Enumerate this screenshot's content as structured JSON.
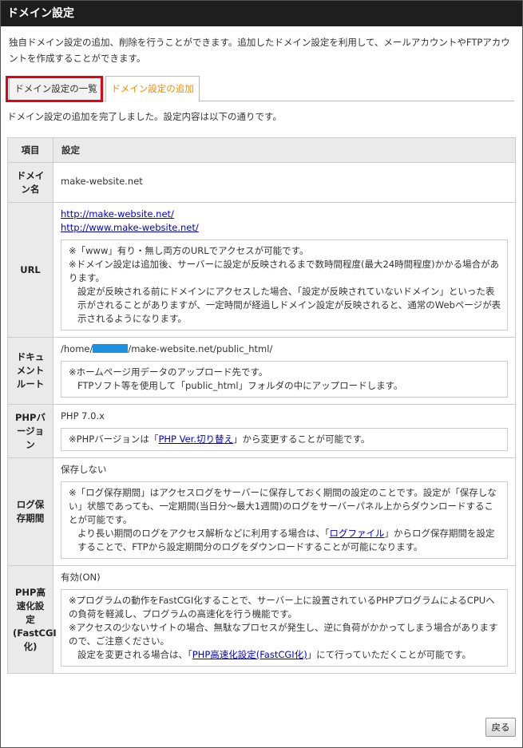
{
  "header": {
    "title": "ドメイン設定"
  },
  "intro": "独自ドメイン設定の追加、削除を行うことができます。追加したドメイン設定を利用して、メールアカウントやFTPアカウントを作成することができます。",
  "tabs": [
    {
      "label": "ドメイン設定の一覧"
    },
    {
      "label": "ドメイン設定の追加"
    }
  ],
  "message": "ドメイン設定の追加を完了しました。設定内容は以下の通りです。",
  "table": {
    "header": {
      "item": "項目",
      "setting": "設定"
    },
    "domain": {
      "label": "ドメイン名",
      "value": "make-website.net"
    },
    "url": {
      "label": "URL",
      "links": [
        "http://make-website.net/",
        "http://www.make-website.net/"
      ],
      "note1": "※「www」有り・無し両方のURLでアクセスが可能です。",
      "note2": "※ドメイン設定は追加後、サーバーに設定が反映されるまで数時間程度(最大24時間程度)かかる場合があります。",
      "note3": "設定が反映される前にドメインにアクセスした場合、「設定が反映されていないドメイン」といった表示がされることがありますが、一定時間が経過しドメイン設定が反映されると、通常のWebページが表示されるようになります。"
    },
    "docroot": {
      "label": "ドキュメントルート",
      "path_prefix": "/home/",
      "path_suffix": "/make-website.net/public_html/",
      "note1": "※ホームページ用データのアップロード先です。",
      "note2": "FTPソフト等を使用して「public_html」フォルダの中にアップロードします。"
    },
    "php": {
      "label": "PHPバージョン",
      "value": "PHP 7.0.x",
      "note_prefix": "※PHPバージョンは「",
      "note_link": "PHP Ver.切り替え",
      "note_suffix": "」から変更することが可能です。"
    },
    "log": {
      "label": "ログ保存期間",
      "value": "保存しない",
      "note1": "※「ログ保存期間」はアクセスログをサーバーに保存しておく期間の設定のことです。設定が「保存しない」状態であっても、一定期間(当日分～最大1週間)のログをサーバーパネル上からダウンロードすることが可能です。",
      "note2_prefix": "より長い期間のログをアクセス解析などに利用する場合は、「",
      "note2_link": "ログファイル",
      "note2_suffix": "」からログ保存期間を設定することで、FTPから設定期間分のログをダウンロードすることが可能になります。"
    },
    "fastcgi": {
      "label": "PHP高速化設定(FastCGI化)",
      "value": "有効(ON)",
      "note1": "※プログラムの動作をFastCGI化することで、サーバー上に設置されているPHPプログラムによるCPUへの負荷を軽減し、プログラムの高速化を行う機能です。",
      "note2": "※アクセスの少ないサイトの場合、無駄なプロセスが発生し、逆に負荷がかかってしまう場合がありますので、ご注意ください。",
      "note3_prefix": "設定を変更される場合は、「",
      "note3_link": "PHP高速化設定(FastCGI化)",
      "note3_suffix": "」にて行っていただくことが可能です。"
    }
  },
  "buttons": {
    "back": "戻る"
  },
  "colors": {
    "titlebar": "#1e1e1e",
    "active_tab": "#f08c00",
    "highlight": "#e60012",
    "link": "#0000cc"
  }
}
